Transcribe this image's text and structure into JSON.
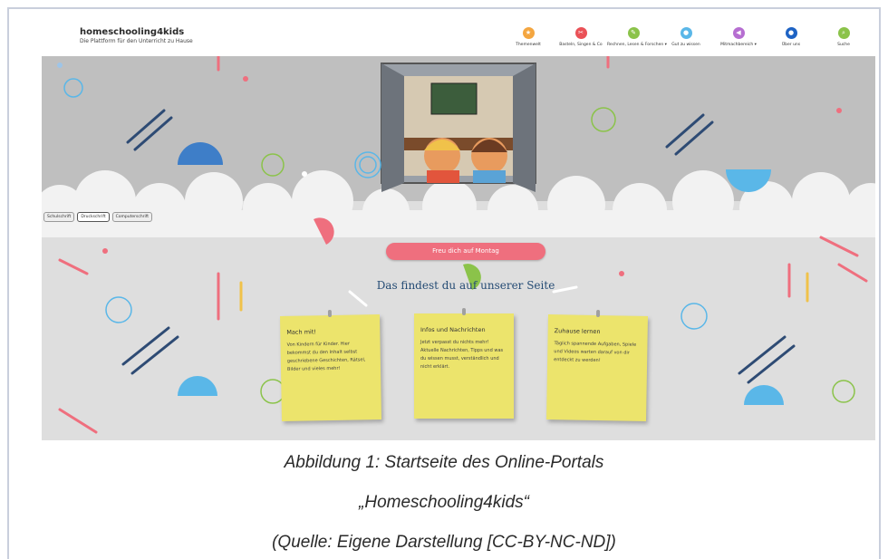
{
  "site": {
    "brand_name": "homeschooling4kids",
    "brand_tagline": "Die Plattform für den Unterricht zu Hause"
  },
  "nav": [
    {
      "label": "Themenwelt",
      "color": "#f4a640",
      "icon": "star-icon"
    },
    {
      "label": "Basteln, Singen & Co",
      "color": "#ea5157",
      "icon": "scissors-icon"
    },
    {
      "label": "Rechnen, Lesen & Forschen ▾",
      "color": "#8bc34a",
      "icon": "pencil-icon"
    },
    {
      "label": "Gut zu wissen",
      "color": "#5ab7e8",
      "icon": "bulb-icon"
    },
    {
      "label": "Mitmachbereich ▾",
      "color": "#b66ed1",
      "icon": "megaphone-icon"
    },
    {
      "label": "Über uns",
      "color": "#1e63c4",
      "icon": "group-icon"
    },
    {
      "label": "Suche",
      "color": "#8bc34a",
      "icon": "search-icon"
    }
  ],
  "font_tabs": [
    "Schulschrift",
    "Druckschrift",
    "Computerschrift"
  ],
  "cta": "Freu dich auf Montag",
  "headline": "Das findest du auf unserer Seite",
  "notes": [
    {
      "title": "Mach mit!",
      "body": "Von Kindern für Kinder. Hier bekommst du den Inhalt selbst geschriebene Geschichten, Rätsel, Bilder und vieles mehr!"
    },
    {
      "title": "Infos und Nachrichten",
      "body": "Jetzt verpasst du nichts mehr! Aktuelle Nachrichten, Tipps und was du wissen musst, verständlich und nicht erklärt."
    },
    {
      "title": "Zuhause lernen",
      "body": "Täglich spannende Aufgaben, Spiele und Videos warten darauf von dir entdeckt zu werden!"
    }
  ],
  "caption": {
    "line1": "Abbildung 1: Startseite des Online-Portals",
    "line2": "„Homeschooling4kids“",
    "line3": "(Quelle: Eigene Darstellung [CC-BY-NC-ND])"
  }
}
